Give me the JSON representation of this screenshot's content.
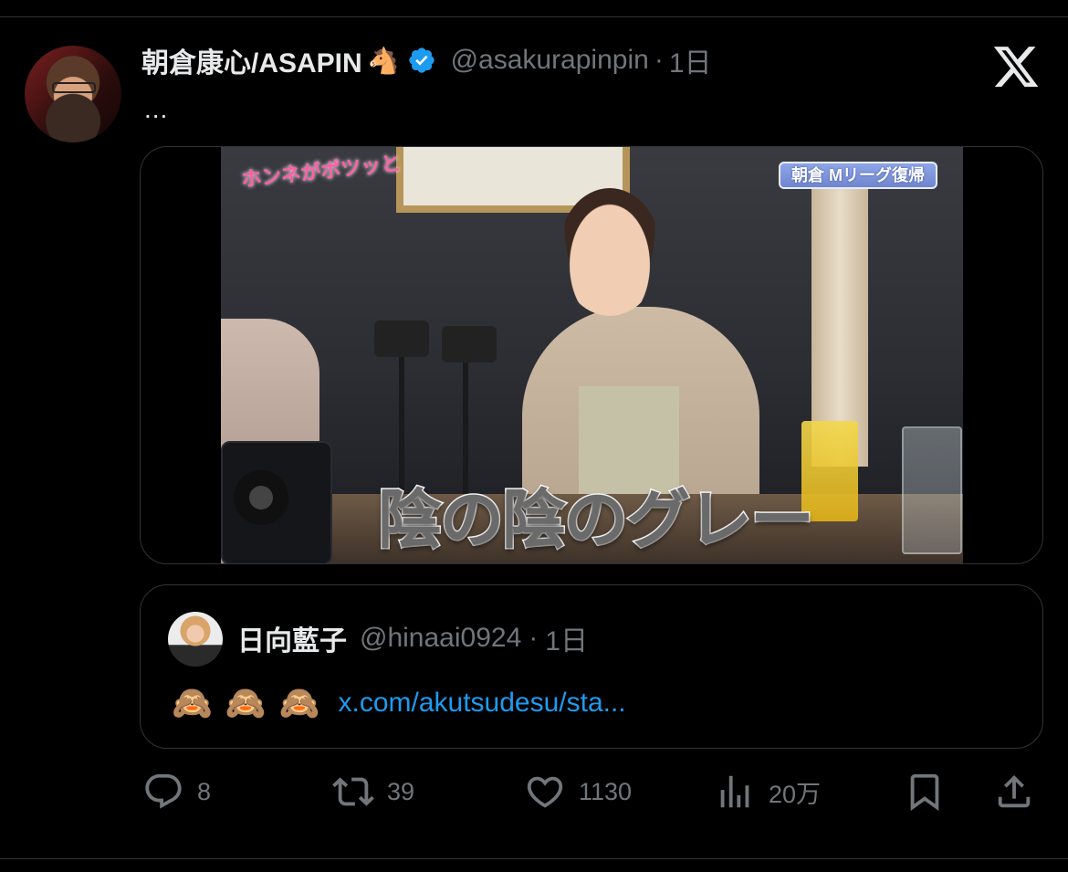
{
  "tweet": {
    "author": {
      "display_name": "朝倉康心/ASAPIN",
      "name_emoji": "🐴",
      "verified": true,
      "handle": "@asakurapinpin",
      "separator": "·",
      "time": "1日"
    },
    "text": "...",
    "media": {
      "show_logo": "ホンネがポツッと",
      "corner_label": "朝倉 Mリーグ復帰",
      "caption": "陰の陰のグレー"
    },
    "quote": {
      "author": {
        "display_name": "日向藍子",
        "handle": "@hinaai0924",
        "separator": "·",
        "time": "1日"
      },
      "emojis": [
        "🙈",
        "🙈",
        "🙈"
      ],
      "link": "x.com/akutsudesu/sta..."
    },
    "actions": {
      "replies": "8",
      "reposts": "39",
      "likes": "1130",
      "views": "20万"
    }
  },
  "icons": {
    "brand": "x-logo-icon",
    "verified": "verified-badge-icon",
    "reply": "reply-icon",
    "repost": "repost-icon",
    "like": "heart-icon",
    "views": "views-icon",
    "bookmark": "bookmark-icon",
    "share": "share-icon"
  },
  "colors": {
    "background": "#000000",
    "text": "#e7e9ea",
    "secondary": "#71767b",
    "link": "#1d9bf0",
    "border": "#2f3336",
    "verified": "#1d9bf0"
  }
}
